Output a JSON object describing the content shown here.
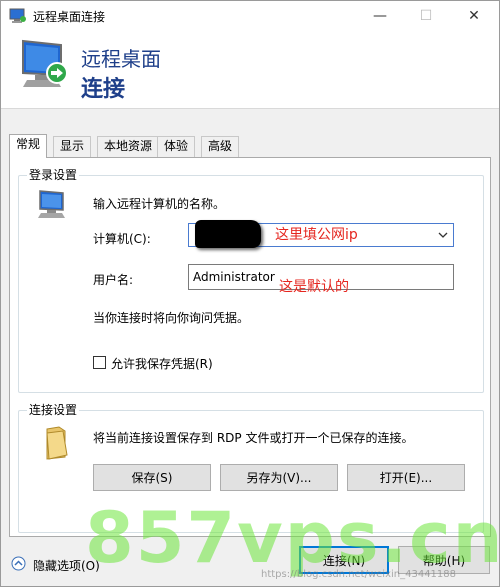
{
  "window": {
    "title": "远程桌面连接",
    "controls": {
      "minimize": "—",
      "maximize": "☐",
      "close": "✕"
    }
  },
  "banner": {
    "line1": "远程桌面",
    "line2": "连接"
  },
  "tabs": [
    {
      "label": "常规",
      "active": true
    },
    {
      "label": "显示",
      "active": false
    },
    {
      "label": "本地资源",
      "active": false
    },
    {
      "label": "体验",
      "active": false
    },
    {
      "label": "高级",
      "active": false
    }
  ],
  "login": {
    "group_label": "登录设置",
    "prompt": "输入远程计算机的名称。",
    "computer_label": "计算机(C):",
    "computer_annotation": "这里填公网ip",
    "username_label": "用户名:",
    "username_value": "Administrator",
    "username_annotation": "这是默认的",
    "credential_note": "当你连接时将向你询问凭据。",
    "allow_save_label": "允许我保存凭据(R)"
  },
  "connection": {
    "group_label": "连接设置",
    "description": "将当前连接设置保存到 RDP 文件或打开一个已保存的连接。",
    "save_label": "保存(S)",
    "save_as_label": "另存为(V)...",
    "open_label": "打开(E)..."
  },
  "footer": {
    "hide_options_label": "隐藏选项(O)",
    "connect_label": "连接(N)",
    "help_label": "帮助(H)"
  },
  "overlay": {
    "watermark": "857vps.cn",
    "source_credit": "https://blog.csdn.net/weixin_43441188"
  },
  "colors": {
    "accent": "#0078d7",
    "banner_text": "#1e3f8a",
    "annotation": "#e5261f"
  }
}
